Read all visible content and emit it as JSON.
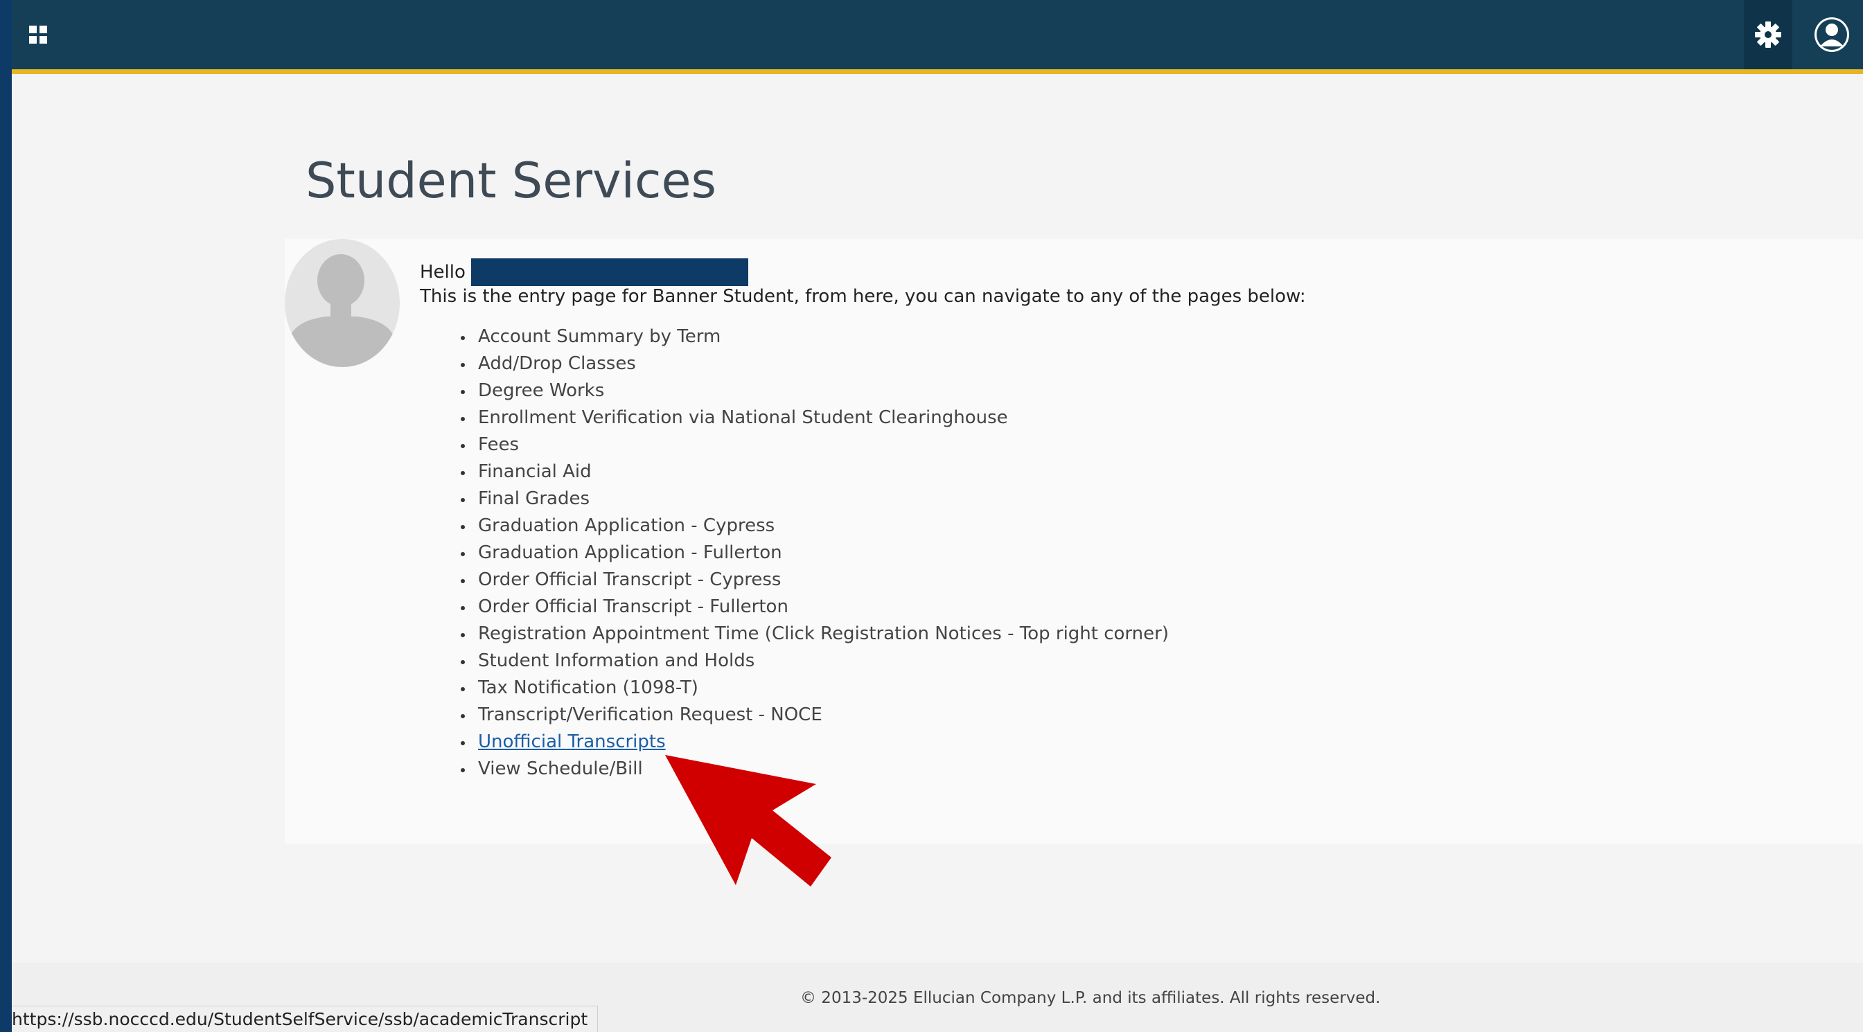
{
  "header": {
    "menu_icon": "grid-menu-icon",
    "tools_icon": "gear-icon",
    "profile_icon": "user-circle-icon",
    "bar_color": "#153f57",
    "accent_color": "#e6b624"
  },
  "page": {
    "title": "Student Services",
    "hello": "Hello",
    "intro": "This is the entry page for Banner Student, from here, you can navigate to any of the pages below:"
  },
  "links": [
    {
      "label": "Account Summary by Term"
    },
    {
      "label": "Add/Drop Classes"
    },
    {
      "label": "Degree Works"
    },
    {
      "label": "Enrollment Verification via National Student Clearinghouse"
    },
    {
      "label": "Fees"
    },
    {
      "label": "Financial Aid"
    },
    {
      "label": "Final Grades"
    },
    {
      "label": "Graduation Application - Cypress"
    },
    {
      "label": "Graduation Application - Fullerton"
    },
    {
      "label": "Order Official Transcript - Cypress"
    },
    {
      "label": "Order Official Transcript - Fullerton"
    },
    {
      "label": "Registration Appointment Time (Click Registration Notices - Top right corner)"
    },
    {
      "label": "Student Information and Holds"
    },
    {
      "label": "Tax Notification (1098-T)"
    },
    {
      "label": "Transcript/Verification Request - NOCE"
    },
    {
      "label": "Unofficial Transcripts"
    },
    {
      "label": "View Schedule/Bill"
    }
  ],
  "footer": {
    "copyright": "© 2013-2025 Ellucian Company L.P. and its affiliates. All rights reserved."
  },
  "status_bar": {
    "url": "https://ssb.nocccd.edu/StudentSelfService/ssb/academicTranscript"
  }
}
